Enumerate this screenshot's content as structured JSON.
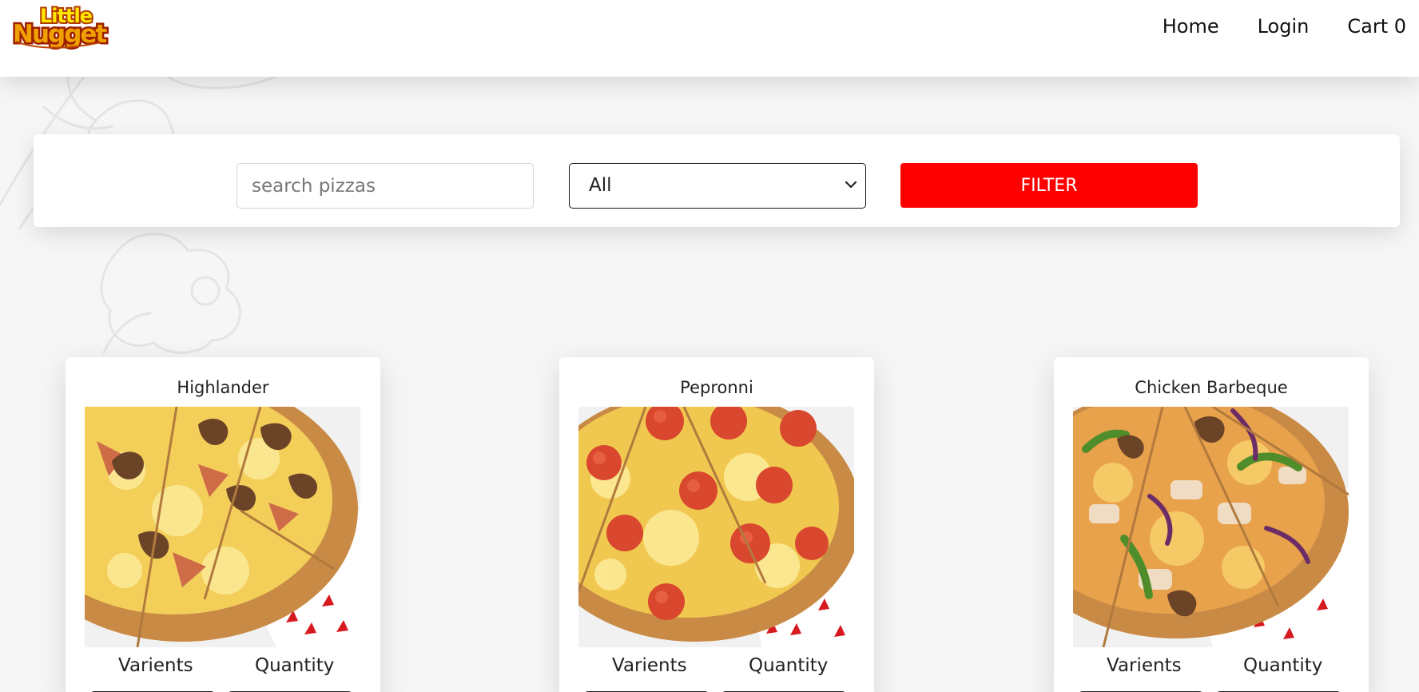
{
  "brand": {
    "logo_top": "Little",
    "logo_bottom": "Nugget"
  },
  "nav": {
    "home": "Home",
    "login": "Login",
    "cart": "Cart 0"
  },
  "filter": {
    "search_placeholder": "search pizzas",
    "category_selected": "All",
    "button_label": "FILTER"
  },
  "colors": {
    "brand_red": "#ff0000",
    "logo_yellow": "#ffdd00",
    "logo_orange": "#e05f00"
  },
  "pizzas": [
    {
      "name": "Highlander",
      "variants_label": "Varients",
      "quantity_label": "Quantity"
    },
    {
      "name": "Pepronni",
      "variants_label": "Varients",
      "quantity_label": "Quantity"
    },
    {
      "name": "Chicken Barbeque",
      "variants_label": "Varients",
      "quantity_label": "Quantity"
    }
  ]
}
